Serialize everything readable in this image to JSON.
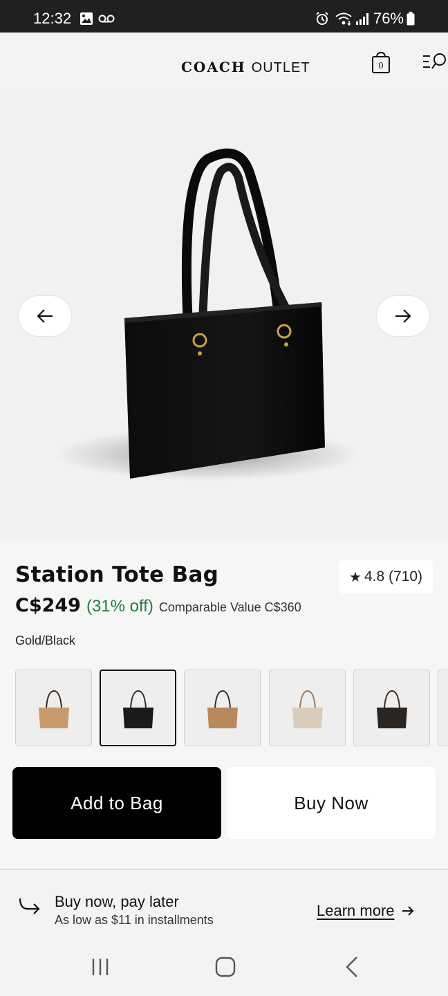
{
  "status_bar": {
    "time": "12:32",
    "battery": "76%",
    "icons": [
      "image-icon",
      "voicemail-icon",
      "alarm-icon",
      "wifi-icon",
      "signal-icon",
      "battery-icon"
    ]
  },
  "header": {
    "brand_logo": "COACH",
    "brand_suffix": "OUTLET",
    "bag_count": "0",
    "icons": [
      "shopping-bag-icon",
      "menu-search-icon"
    ]
  },
  "gallery": {
    "icons": [
      "arrow-left-icon",
      "arrow-right-icon"
    ]
  },
  "product": {
    "title": "Station Tote Bag",
    "rating": "4.8 (710)",
    "price": "C$249",
    "discount": "(31% off)",
    "comparable": "Comparable Value C$360",
    "color": "Gold/Black",
    "swatch_colors": [
      "#c79a6c",
      "#1a1a1a",
      "#b9895e",
      "#d9cdb9",
      "#2b2522"
    ],
    "selected_swatch_index": 1
  },
  "actions": {
    "add_to_bag": "Add to Bag",
    "buy_now": "Buy Now"
  },
  "bnpl": {
    "title": "Buy now, pay later",
    "subtitle": "As low as $11 in installments",
    "learn_more": "Learn more"
  },
  "colors": {
    "discount_green": "#1a7f3f",
    "primary_button": "#000000",
    "status_bar": "#202020"
  }
}
